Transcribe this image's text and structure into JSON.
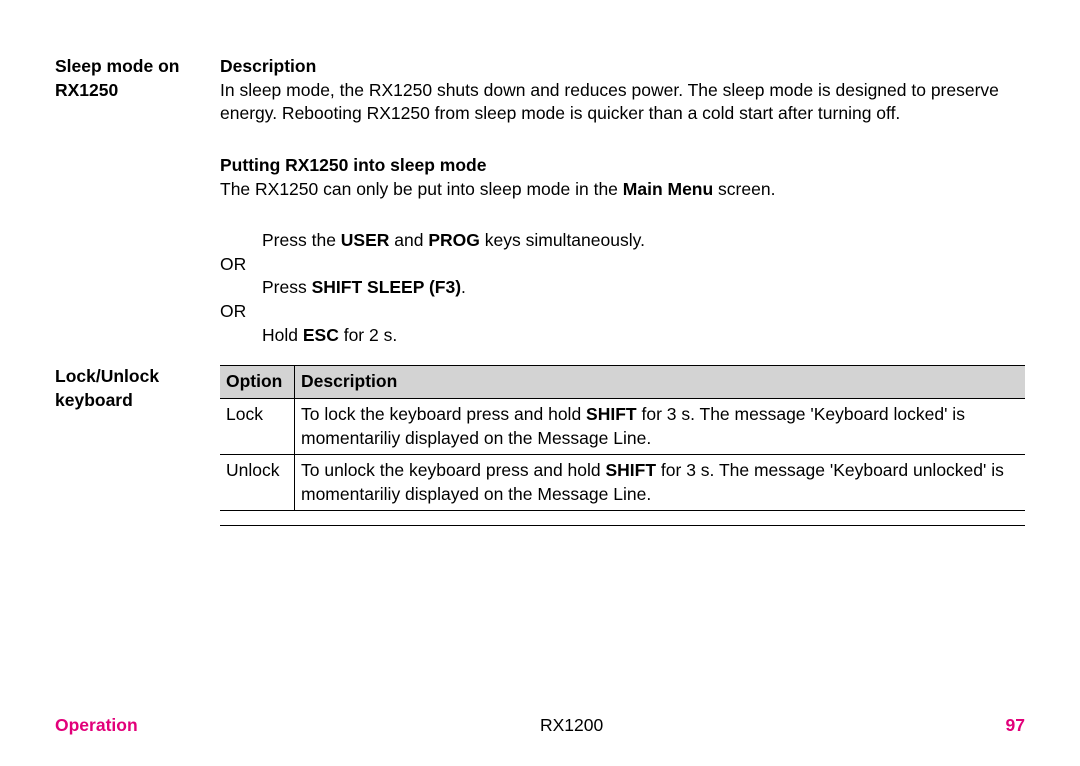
{
  "section1": {
    "heading": "Sleep mode on RX1250",
    "descLabel": "Description",
    "descText": "In sleep mode, the RX1250 shuts down and reduces power. The sleep mode is designed to preserve energy. Rebooting RX1250 from sleep mode is quicker than a cold start after turning off.",
    "sub2Label": "Putting RX1250 into sleep mode",
    "sub2Text_a": "The RX1250 can only be put into sleep mode in the ",
    "sub2Text_b": "Main Menu",
    "sub2Text_c": " screen.",
    "step1_a": "Press the ",
    "step1_b": "USER",
    "step1_c": " and ",
    "step1_d": "PROG",
    "step1_e": " keys simultaneously.",
    "or": "OR",
    "step2_a": "Press ",
    "step2_b": "SHIFT SLEEP (F3)",
    "step2_c": ".",
    "step3_a": "Hold ",
    "step3_b": "ESC",
    "step3_c": " for 2 s."
  },
  "section2": {
    "heading": "Lock/Unlock keyboard",
    "col1": "Option",
    "col2": "Description",
    "row1": {
      "opt": "Lock",
      "d_a": "To lock the keyboard press and hold ",
      "d_b": "SHIFT",
      "d_c": " for 3 s. The message 'Keyboard locked' is momentariliy displayed on the Message Line."
    },
    "row2": {
      "opt": "Unlock",
      "d_a": "To unlock the keyboard press and hold ",
      "d_b": "SHIFT",
      "d_c": " for 3 s. The message 'Keyboard unlocked' is momentariliy displayed on the Message Line."
    }
  },
  "footer": {
    "left": "Operation",
    "center": "RX1200",
    "right": "97"
  }
}
